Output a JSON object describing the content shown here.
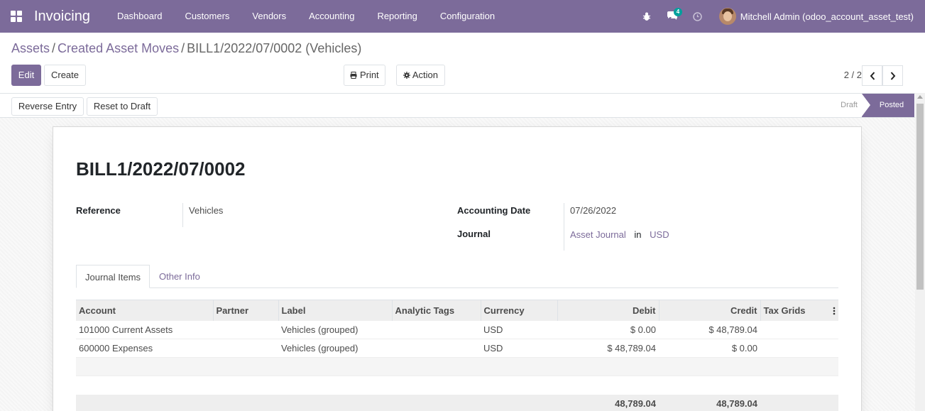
{
  "navbar": {
    "app_name": "Invoicing",
    "menu": [
      "Dashboard",
      "Customers",
      "Vendors",
      "Accounting",
      "Reporting",
      "Configuration"
    ],
    "messages_badge": "4",
    "user_name": "Mitchell Admin (odoo_account_asset_test)"
  },
  "breadcrumb": {
    "items": [
      "Assets",
      "Created Asset Moves"
    ],
    "separator": "/",
    "current": "BILL1/2022/07/0002 (Vehicles)"
  },
  "control": {
    "edit_label": "Edit",
    "create_label": "Create",
    "print_label": "Print",
    "action_label": "Action",
    "pager": "2 / 2"
  },
  "statusbar": {
    "reverse_label": "Reverse Entry",
    "reset_label": "Reset to Draft",
    "stages": [
      "Draft",
      "Posted"
    ]
  },
  "form": {
    "title": "BILL1/2022/07/0002",
    "reference_label": "Reference",
    "reference_value": "Vehicles",
    "date_label": "Accounting Date",
    "date_value": "07/26/2022",
    "journal_label": "Journal",
    "journal_value": "Asset Journal",
    "in_word": "in",
    "currency_value": "USD"
  },
  "tabs": [
    "Journal Items",
    "Other Info"
  ],
  "table": {
    "headers": [
      "Account",
      "Partner",
      "Label",
      "Analytic Tags",
      "Currency",
      "Debit",
      "Credit",
      "Tax Grids"
    ],
    "rows": [
      {
        "account": "101000 Current Assets",
        "partner": "",
        "label": "Vehicles (grouped)",
        "tags": "",
        "currency": "USD",
        "debit": "$ 0.00",
        "credit": "$ 48,789.04",
        "tax": ""
      },
      {
        "account": "600000 Expenses",
        "partner": "",
        "label": "Vehicles (grouped)",
        "tags": "",
        "currency": "USD",
        "debit": "$ 48,789.04",
        "credit": "$ 0.00",
        "tax": ""
      }
    ],
    "total_debit": "48,789.04",
    "total_credit": "48,789.04"
  },
  "colors": {
    "brand": "#7c6b9a",
    "badge": "#00a09d"
  }
}
